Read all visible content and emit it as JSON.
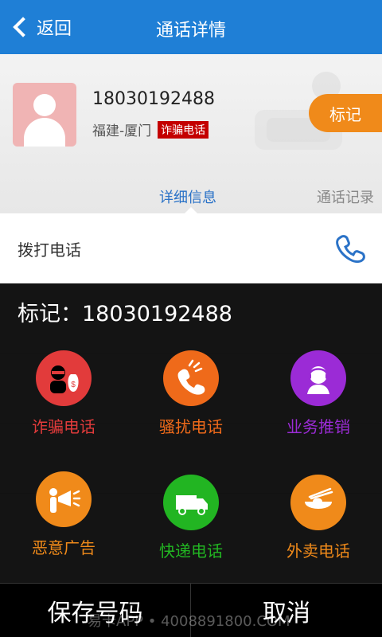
{
  "topbar": {
    "back_label": "返回",
    "title": "通话详情"
  },
  "contact": {
    "number": "18030192488",
    "location": "福建-厦门",
    "tag": "诈骗电话",
    "mark_label": "标记"
  },
  "tabs": {
    "detail": "详细信息",
    "records": "通话记录"
  },
  "call_row": {
    "label": "拨打电话"
  },
  "sheet": {
    "title": "标记：18030192488",
    "items": [
      {
        "label": "诈骗电话",
        "icon": "fraud-thief-icon",
        "circle_color": "#e23b3b",
        "text_color": "#e23b3b"
      },
      {
        "label": "骚扰电话",
        "icon": "harass-phone-icon",
        "circle_color": "#ef6a1a",
        "text_color": "#ef6a1a"
      },
      {
        "label": "业务推销",
        "icon": "sales-agent-icon",
        "circle_color": "#9b2bd6",
        "text_color": "#9b2bd6"
      },
      {
        "label": "恶意广告",
        "icon": "megaphone-icon",
        "circle_color": "#f08a1a",
        "text_color": "#f08a1a"
      },
      {
        "label": "快递电话",
        "icon": "delivery-truck-icon",
        "circle_color": "#22b522",
        "text_color": "#22b522"
      },
      {
        "label": "外卖电话",
        "icon": "food-bowl-icon",
        "circle_color": "#f08a1a",
        "text_color": "#f08a1a"
      }
    ],
    "save_label": "保存号码",
    "cancel_label": "取消"
  },
  "watermark": "易卡APP • 4008891800.COM"
}
